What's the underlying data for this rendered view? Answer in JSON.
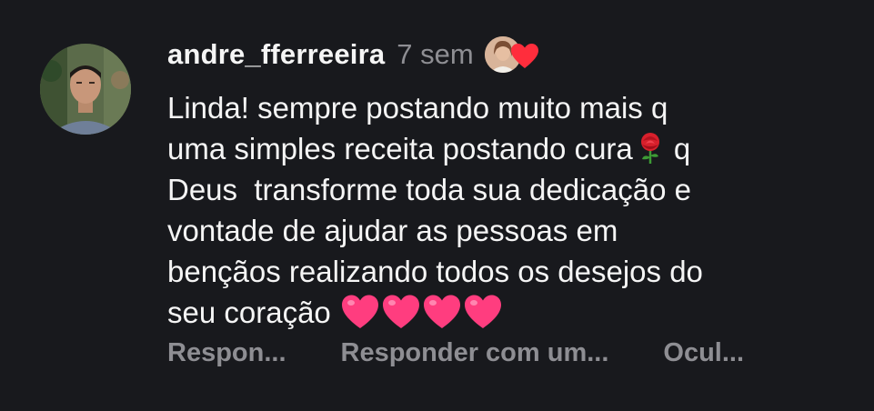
{
  "comment": {
    "username": "andre_fferreeira",
    "time": "7 sem",
    "avatar_icon": "user-avatar",
    "liked_by_icon": "liked-by-author-avatar",
    "liked_heart_color": "#ff2d3c",
    "text_lines": [
      "Linda! sempre postando muito mais q",
      "uma simples receita postando cura",
      "Deus  transforme toda sua dedicação e",
      "vontade de ajudar as pessoas em",
      "bençãos realizando todos os desejos do",
      "seu coração"
    ],
    "rose_suffix": " q",
    "emojis": {
      "rose": "rose-emoji",
      "hearts": [
        "pink-heart-emoji",
        "pink-heart-emoji",
        "pink-heart-emoji",
        "pink-heart-emoji"
      ]
    }
  },
  "actions": {
    "reply": "Respon...",
    "reply_with": "Responder com um...",
    "hide": "Ocul..."
  }
}
